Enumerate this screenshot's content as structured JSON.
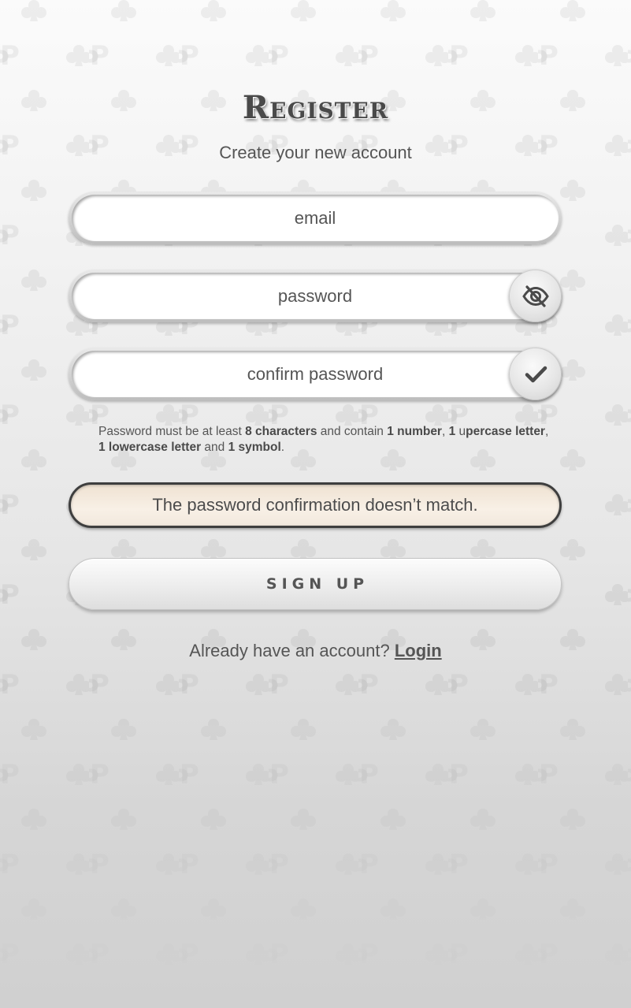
{
  "title": "Register",
  "subtitle": "Create your new account",
  "form": {
    "email": {
      "value": "",
      "placeholder": "email"
    },
    "password": {
      "value": "",
      "placeholder": "password",
      "toggle_icon": "eye-slash-icon"
    },
    "confirm_password": {
      "value": "",
      "placeholder": "confirm password",
      "status_icon": "checkmark-icon"
    }
  },
  "hint": {
    "p1": "Password must be at least ",
    "b1": "8 characters",
    "p2": " and contain ",
    "b2": "1 number",
    "p3": ", ",
    "b3": "1",
    "p4": " u",
    "b4": "percase letter",
    "p5": ", ",
    "b5": "1 lowercase letter",
    "p6": "  and ",
    "b6": "1 symbol",
    "p7": "."
  },
  "error_message": "The password confirmation doesn’t match.",
  "signup_label": "SIGN UP",
  "login": {
    "prompt": "Already have an account? ",
    "link": "Login"
  },
  "colors": {
    "text": "#555555",
    "title": "#4a4a4a",
    "error_bg": "#f5ebe0",
    "error_border": "#3e3e3e"
  }
}
